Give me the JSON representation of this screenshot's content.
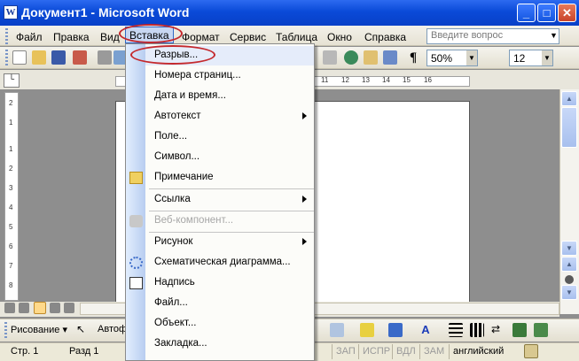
{
  "window": {
    "title": "Документ1 - Microsoft Word",
    "icon_letter": "W",
    "min": "_",
    "max": "□",
    "close": "✕"
  },
  "menubar": {
    "items": [
      "Файл",
      "Правка",
      "Вид",
      "Вставка",
      "Формат",
      "Сервис",
      "Таблица",
      "Окно",
      "Справка"
    ],
    "help_placeholder": "Введите вопрос"
  },
  "toolbar": {
    "zoom": "50%",
    "font_size": "12",
    "pilcrow": "¶"
  },
  "ruler": {
    "numbers": [
      "11",
      "12",
      "13",
      "14",
      "15",
      "16"
    ],
    "vmarks": [
      "2",
      "1",
      "1",
      "2",
      "3",
      "4",
      "5",
      "6",
      "7",
      "8"
    ]
  },
  "insert_menu": {
    "items": [
      {
        "label": "Разрыв...",
        "submenu": false,
        "disabled": false,
        "icon": null
      },
      {
        "label": "Номера страниц...",
        "submenu": false,
        "disabled": false,
        "icon": null
      },
      {
        "label": "Дата и время...",
        "submenu": false,
        "disabled": false,
        "icon": null
      },
      {
        "label": "Автотекст",
        "submenu": true,
        "disabled": false,
        "icon": null
      },
      {
        "label": "Поле...",
        "submenu": false,
        "disabled": false,
        "icon": null
      },
      {
        "label": "Символ...",
        "submenu": false,
        "disabled": false,
        "icon": null
      },
      {
        "label": "Примечание",
        "submenu": false,
        "disabled": false,
        "icon": "note-icon"
      },
      {
        "label": "Ссылка",
        "submenu": true,
        "disabled": false,
        "icon": null
      },
      {
        "label": "Веб-компонент...",
        "submenu": false,
        "disabled": true,
        "icon": "web-component-icon"
      },
      {
        "label": "Рисунок",
        "submenu": true,
        "disabled": false,
        "icon": null
      },
      {
        "label": "Схематическая диаграмма...",
        "submenu": false,
        "disabled": false,
        "icon": "diagram-icon"
      },
      {
        "label": "Надпись",
        "submenu": false,
        "disabled": false,
        "icon": "textbox-icon"
      },
      {
        "label": "Файл...",
        "submenu": false,
        "disabled": false,
        "icon": null
      },
      {
        "label": "Объект...",
        "submenu": false,
        "disabled": false,
        "icon": null
      },
      {
        "label": "Закладка...",
        "submenu": false,
        "disabled": false,
        "icon": null
      }
    ]
  },
  "drawing": {
    "draw_label": "Рисование ▾",
    "autoshapes_label": "Автоф"
  },
  "statusbar": {
    "page": "Стр. 1",
    "section": "Разд 1",
    "rec": "ЗАП",
    "trk": "ИСПР",
    "ext": "ВДЛ",
    "ovr": "ЗАМ",
    "lang": "английский"
  },
  "colors": {
    "title_bar": "#0a4ad8",
    "menu_highlight": "#c8d7f2",
    "annotation": "#c4282c"
  }
}
